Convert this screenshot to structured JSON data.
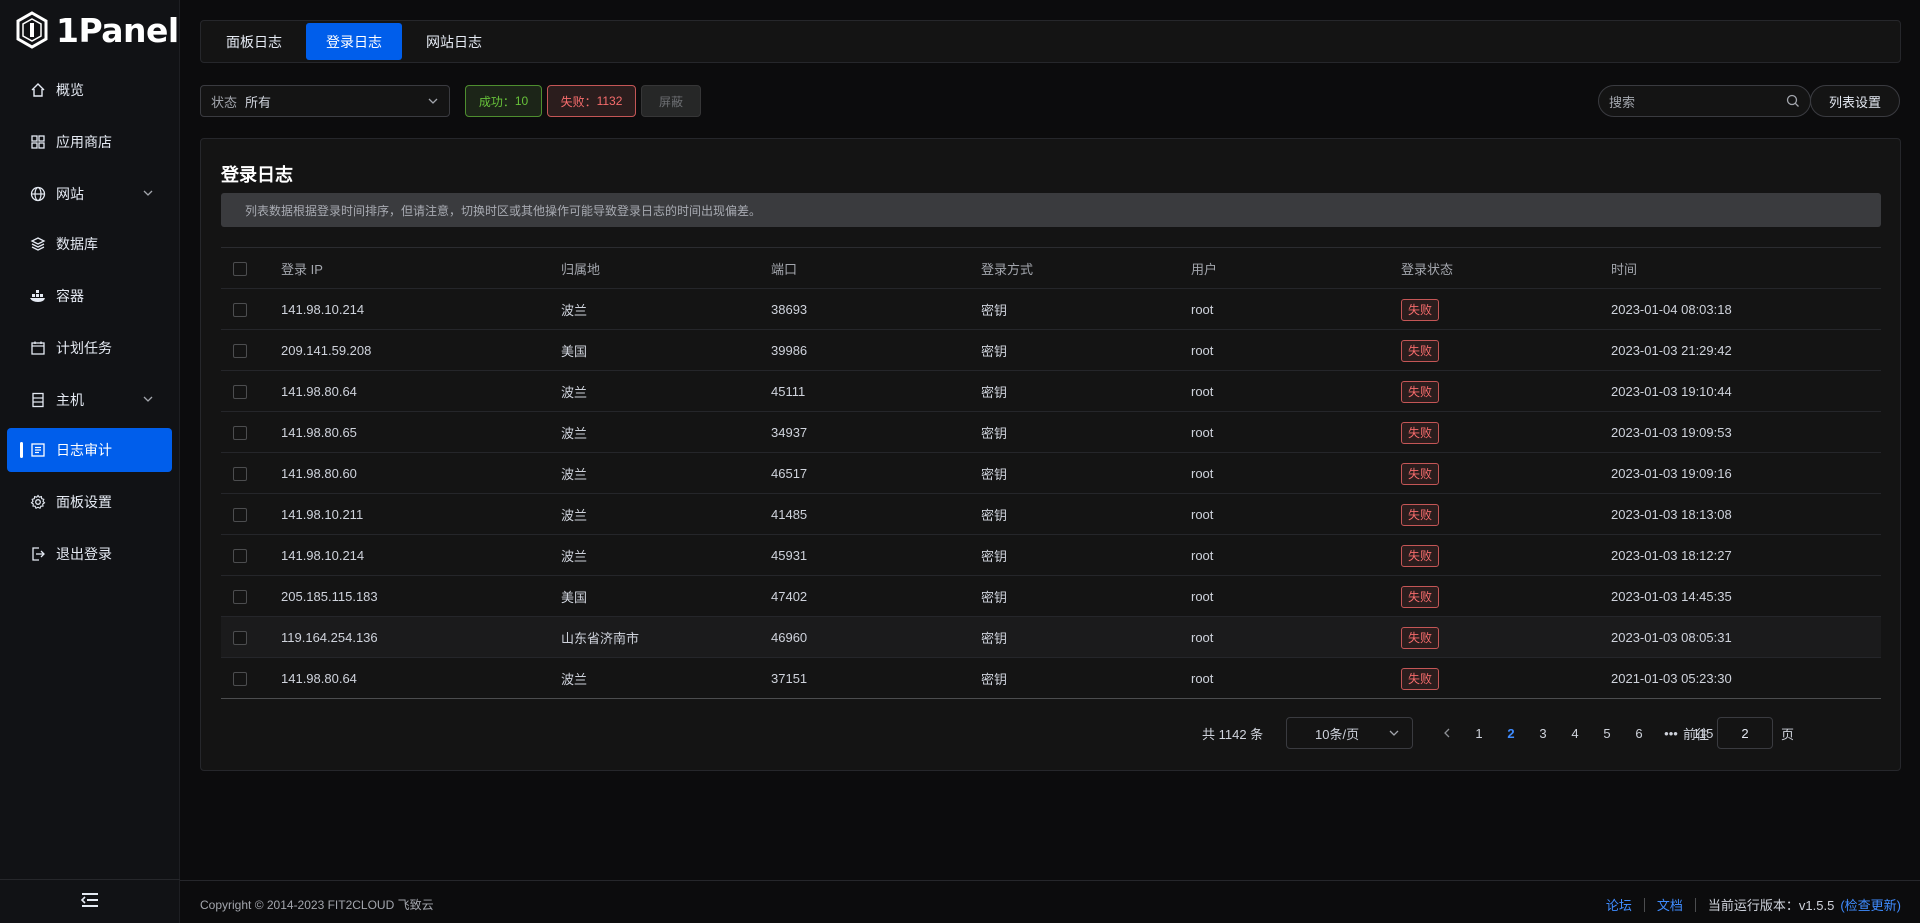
{
  "app": {
    "logo_text": "1Panel"
  },
  "sidebar": {
    "items": [
      {
        "label": "概览",
        "icon": "home-icon"
      },
      {
        "label": "应用商店",
        "icon": "grid-icon"
      },
      {
        "label": "网站",
        "icon": "globe-icon",
        "expandable": true
      },
      {
        "label": "数据库",
        "icon": "layers-icon"
      },
      {
        "label": "容器",
        "icon": "docker-icon"
      },
      {
        "label": "计划任务",
        "icon": "calendar-icon"
      },
      {
        "label": "主机",
        "icon": "server-icon",
        "expandable": true
      },
      {
        "label": "日志审计",
        "icon": "log-icon",
        "active": true
      },
      {
        "label": "面板设置",
        "icon": "gear-icon"
      },
      {
        "label": "退出登录",
        "icon": "logout-icon"
      }
    ]
  },
  "tabs": [
    {
      "label": "面板日志",
      "active": false
    },
    {
      "label": "登录日志",
      "active": true
    },
    {
      "label": "网站日志",
      "active": false
    }
  ],
  "filters": {
    "status_label": "状态",
    "status_value": "所有",
    "success_label": "成功：",
    "success_count": "10",
    "fail_label": "失败：",
    "fail_count": "1132",
    "hide_label": "屏蔽",
    "search_placeholder": "搜索",
    "column_settings": "列表设置"
  },
  "card": {
    "title": "登录日志",
    "notice": "列表数据根据登录时间排序，但请注意，切换时区或其他操作可能导致登录日志的时间出现偏差。"
  },
  "table": {
    "headers": {
      "ip": "登录 IP",
      "location": "归属地",
      "port": "端口",
      "method": "登录方式",
      "user": "用户",
      "status": "登录状态",
      "time": "时间"
    },
    "rows": [
      {
        "ip": "141.98.10.214",
        "location": "波兰",
        "port": "38693",
        "method": "密钥",
        "user": "root",
        "status": "失败",
        "time": "2023-01-04 08:03:18"
      },
      {
        "ip": "209.141.59.208",
        "location": "美国",
        "port": "39986",
        "method": "密钥",
        "user": "root",
        "status": "失败",
        "time": "2023-01-03 21:29:42"
      },
      {
        "ip": "141.98.80.64",
        "location": "波兰",
        "port": "45111",
        "method": "密钥",
        "user": "root",
        "status": "失败",
        "time": "2023-01-03 19:10:44"
      },
      {
        "ip": "141.98.80.65",
        "location": "波兰",
        "port": "34937",
        "method": "密钥",
        "user": "root",
        "status": "失败",
        "time": "2023-01-03 19:09:53"
      },
      {
        "ip": "141.98.80.60",
        "location": "波兰",
        "port": "46517",
        "method": "密钥",
        "user": "root",
        "status": "失败",
        "time": "2023-01-03 19:09:16"
      },
      {
        "ip": "141.98.10.211",
        "location": "波兰",
        "port": "41485",
        "method": "密钥",
        "user": "root",
        "status": "失败",
        "time": "2023-01-03 18:13:08"
      },
      {
        "ip": "141.98.10.214",
        "location": "波兰",
        "port": "45931",
        "method": "密钥",
        "user": "root",
        "status": "失败",
        "time": "2023-01-03 18:12:27"
      },
      {
        "ip": "205.185.115.183",
        "location": "美国",
        "port": "47402",
        "method": "密钥",
        "user": "root",
        "status": "失败",
        "time": "2023-01-03 14:45:35"
      },
      {
        "ip": "119.164.254.136",
        "location": "山东省济南市",
        "port": "46960",
        "method": "密钥",
        "user": "root",
        "status": "失败",
        "time": "2023-01-03 08:05:31"
      },
      {
        "ip": "141.98.80.64",
        "location": "波兰",
        "port": "37151",
        "method": "密钥",
        "user": "root",
        "status": "失败",
        "time": "2021-01-03 05:23:30"
      }
    ]
  },
  "pagination": {
    "total_text": "共 1142 条",
    "page_size": "10条/页",
    "pages": [
      "1",
      "2",
      "3",
      "4",
      "5",
      "6",
      "•••",
      "115"
    ],
    "current_page": "2",
    "goto_label": "前往",
    "goto_value": "2",
    "page_suffix": "页"
  },
  "footer": {
    "copyright": "Copyright © 2014-2023 FIT2CLOUD 飞致云",
    "forum": "论坛",
    "docs": "文档",
    "version_text": "当前运行版本：v1.5.5",
    "check_update": "(检查更新)"
  },
  "colors": {
    "accent": "#005eeb",
    "fail": "#f56c6c",
    "success": "#67c23a"
  }
}
